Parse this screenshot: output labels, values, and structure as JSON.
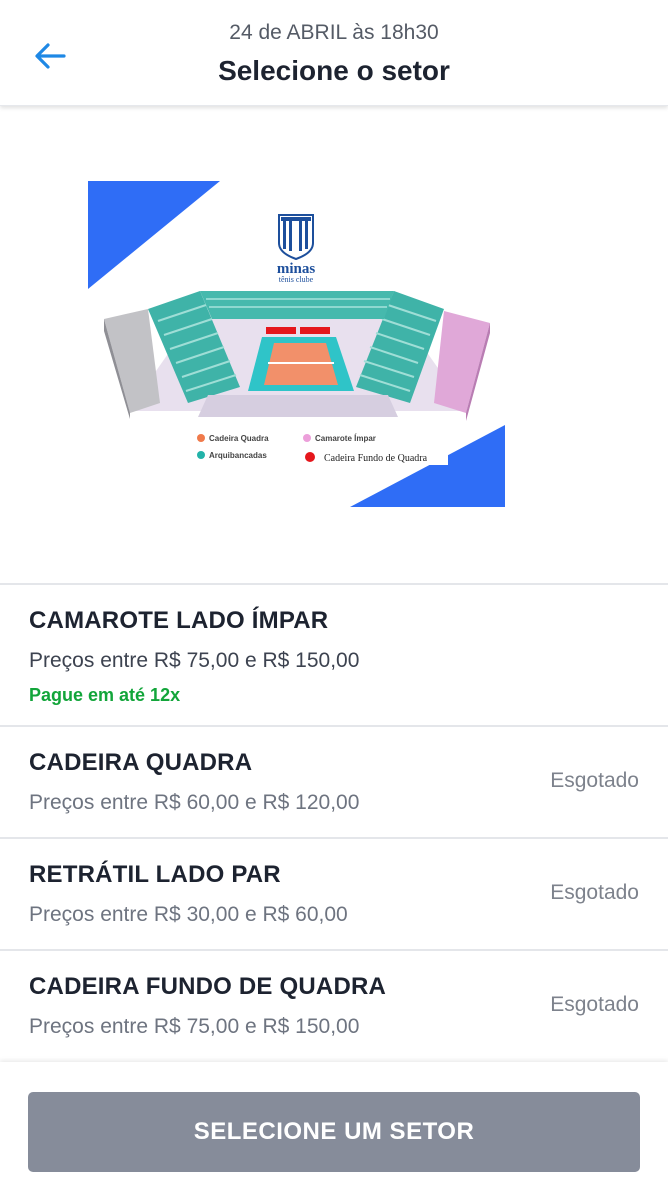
{
  "header": {
    "date": "24 de ABRIL às 18h30",
    "title": "Selecione o setor"
  },
  "venue_map": {
    "club_name": "minas",
    "club_subtitle": "tênis clube",
    "legend": [
      {
        "label": "Cadeira Quadra",
        "color": "#f07a4b"
      },
      {
        "label": "Camarote Ímpar",
        "color": "#ec9fda"
      },
      {
        "label": "Arquibancadas",
        "color": "#23b3a9"
      },
      {
        "label": "Cadeira Fundo de Quadra",
        "color": "#e5161c"
      }
    ],
    "accent_color": "#2f6df6"
  },
  "sectors": [
    {
      "name": "CAMAROTE LADO ÍMPAR",
      "price": "Preços entre R$ 75,00 e R$ 150,00",
      "installments": "Pague em até 12x",
      "status": ""
    },
    {
      "name": "CADEIRA QUADRA",
      "price": "Preços entre R$ 60,00 e R$ 120,00",
      "status": "Esgotado"
    },
    {
      "name": "RETRÁTIL LADO PAR",
      "price": "Preços entre R$ 30,00 e R$ 60,00",
      "status": "Esgotado"
    },
    {
      "name": "CADEIRA FUNDO DE QUADRA",
      "price": "Preços entre R$ 75,00 e R$ 150,00",
      "status": "Esgotado"
    }
  ],
  "footer": {
    "button_label": "SELECIONE UM SETOR"
  },
  "colors": {
    "back_arrow": "#1e88e5",
    "installments_green": "#12a53a",
    "button_gray": "#868c9a"
  }
}
